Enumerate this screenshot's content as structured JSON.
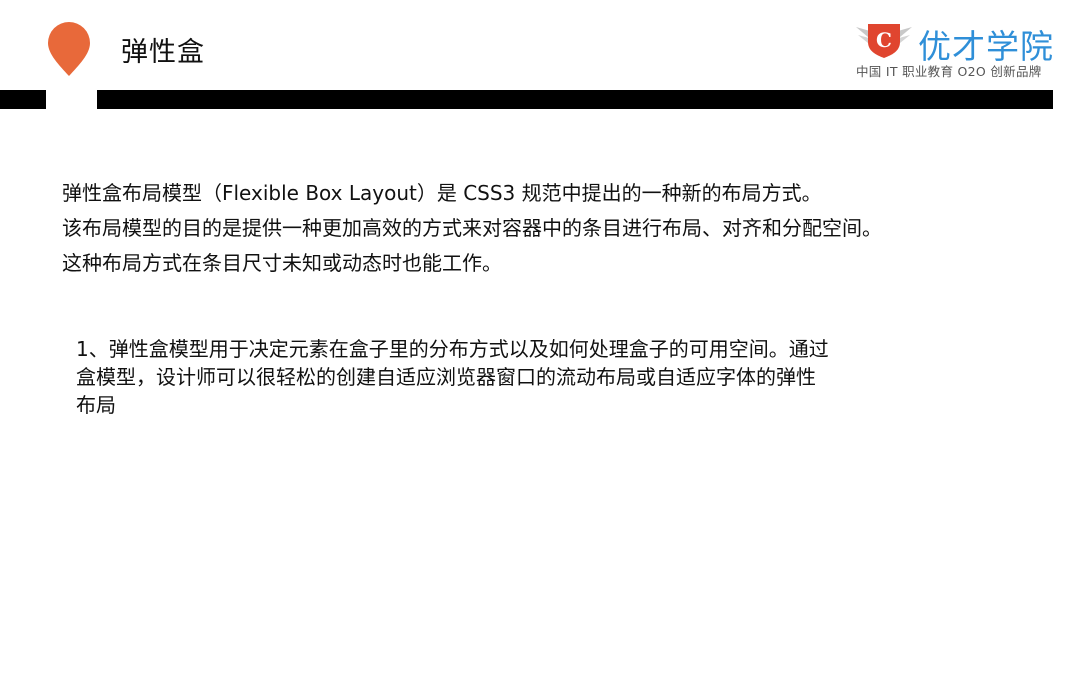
{
  "header": {
    "title": "弹性盒",
    "pin_color": "#e8693a",
    "logo": {
      "badge_letter": "C",
      "name": "优才学院",
      "tagline": "中国 IT 职业教育 O2O 创新品牌",
      "brand_color": "#2f8fd8",
      "badge_color": "#e0452f"
    }
  },
  "intro": {
    "lines": [
      "弹性盒布局模型（Flexible Box Layout）是 CSS3 规范中提出的一种新的布局方式。",
      "该布局模型的目的是提供一种更加高效的方式来对容器中的条目进行布局、对齐和分配空间。",
      "这种布局方式在条目尺寸未知或动态时也能工作。"
    ]
  },
  "point1": {
    "lines": [
      "1、弹性盒模型用于决定元素在盒子里的分布方式以及如何处理盒子的可用空间。通过",
      "盒模型，设计师可以很轻松的创建自适应浏览器窗口的流动布局或自适应字体的弹性",
      "布局"
    ]
  }
}
